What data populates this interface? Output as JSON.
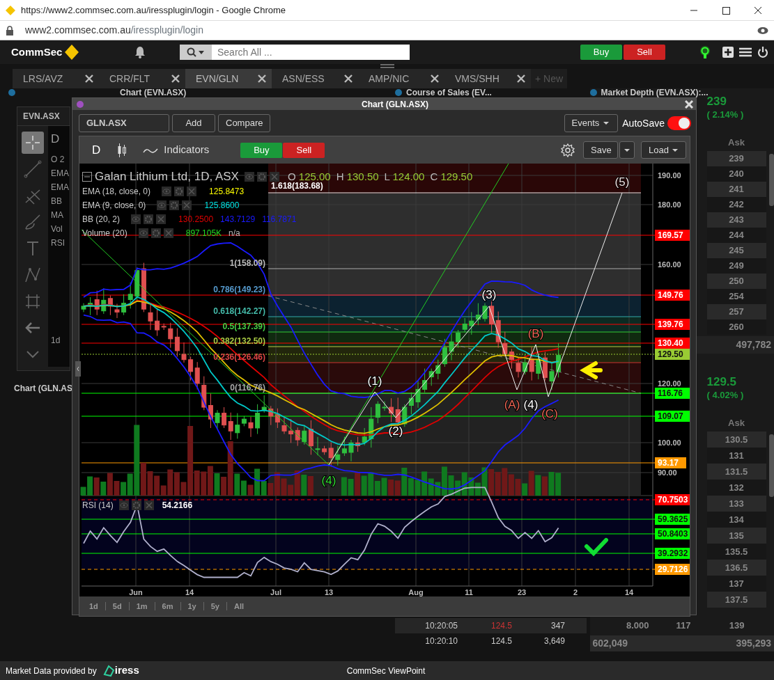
{
  "browser": {
    "title": "https://www2.commsec.com.au/iressplugin/login - Google Chrome",
    "url_host": "www2.commsec.com.au",
    "url_path": "/iressplugin/login"
  },
  "app_header": {
    "logo": "CommSec",
    "search_placeholder": "Search All ...",
    "buy": "Buy",
    "sell": "Sell"
  },
  "tabs": [
    {
      "label": "LRS/AVZ",
      "selected": false
    },
    {
      "label": "CRR/FLT",
      "selected": false
    },
    {
      "label": "EVN/GLN",
      "selected": true
    },
    {
      "label": "ASN/ESS",
      "selected": false
    },
    {
      "label": "AMP/NIC",
      "selected": false
    },
    {
      "label": "VMS/SHH",
      "selected": false
    }
  ],
  "new_tab": "+ New",
  "panels": [
    {
      "title": "Chart (EVN.ASX)"
    },
    {
      "title": "Course of Sales (EV..."
    },
    {
      "title": "Market Depth (EVN.ASX):..."
    }
  ],
  "left_panel": {
    "symbol": "EVN.ASX",
    "fragments": [
      "D",
      "O 2",
      "EMA",
      "EMA",
      "BB",
      "MA",
      "Vol",
      "RSI",
      "1d"
    ],
    "caption": "Chart (GLN.AS"
  },
  "course_of_sales": {
    "rows": [
      {
        "time": "10:20:05",
        "price": "124.5",
        "volume": "347",
        "down": true
      },
      {
        "time": "10:20:10",
        "price": "124.5",
        "volume": "3,649",
        "down": false
      }
    ]
  },
  "depth_top": {
    "price": "239",
    "change": "( 2.14% )",
    "ask_header": "Ask",
    "asks": [
      "239",
      "240",
      "241",
      "242",
      "243",
      "244",
      "245",
      "249",
      "250",
      "254",
      "257",
      "260"
    ],
    "total": "497,782"
  },
  "depth_bottom": {
    "price": "129.5",
    "change": "( 4.02% )",
    "ask_header": "Ask",
    "asks": [
      "130.5",
      "131",
      "131.5",
      "132",
      "133",
      "134",
      "135",
      "135.5",
      "136.5",
      "137",
      "137.5"
    ],
    "last_row": [
      "8.000",
      "117",
      "139"
    ],
    "totals": [
      "602,049",
      "395,293"
    ]
  },
  "chart_window": {
    "title": "Chart (GLN.ASX)",
    "symbol": "GLN.ASX",
    "add": "Add",
    "compare": "Compare",
    "events": "Events",
    "autosave": {
      "label": "AutoSave",
      "on": true
    },
    "toolbar": {
      "period": "D",
      "indicators": "Indicators",
      "buy": "Buy",
      "sell": "Sell",
      "save": "Save",
      "load": "Load"
    },
    "legend": {
      "title": "Galan Lithium Ltd, 1D, ASX",
      "ohlc": [
        {
          "key": "O",
          "value": "125.00"
        },
        {
          "key": "H",
          "value": "130.50"
        },
        {
          "key": "L",
          "value": "124.00"
        },
        {
          "key": "C",
          "value": "129.50"
        }
      ],
      "indicators": [
        {
          "name": "EMA (18, close, 0)",
          "values": [
            {
              "text": "125.8473",
              "color": "#ffff00"
            }
          ]
        },
        {
          "name": "EMA (9, close, 0)",
          "values": [
            {
              "text": "125.8600",
              "color": "#00e5e5"
            }
          ]
        },
        {
          "name": "BB (20, 2)",
          "values": [
            {
              "text": "130.2500",
              "color": "#e00000"
            },
            {
              "text": "143.7129",
              "color": "#1a1aff"
            },
            {
              "text": "116.7871",
              "color": "#1a1aff"
            }
          ]
        },
        {
          "name": "Volume (20)",
          "values": [
            {
              "text": "897.105K",
              "color": "#22dd22"
            },
            {
              "text": "n/a",
              "color": "#bbbbbb"
            }
          ]
        }
      ]
    },
    "fib_labels": [
      {
        "text": "1.618(183.68)",
        "color": "#ffffff"
      },
      {
        "text": "1(158.09)",
        "color": "#bbbbbb"
      },
      {
        "text": "0.786(149.23)",
        "color": "#5599cc"
      },
      {
        "text": "0.618(142.27)",
        "color": "#44bbaa"
      },
      {
        "text": "0.5(137.39)",
        "color": "#44cc44"
      },
      {
        "text": "0.382(132.50)",
        "color": "#aacc44"
      },
      {
        "text": "0.236(126.46)",
        "color": "#dd4444"
      },
      {
        "text": "0(116.76)",
        "color": "#aaaaaa"
      }
    ],
    "wave_labels": [
      {
        "text": "(5)",
        "color": "#f0dcdc"
      },
      {
        "text": "(3)",
        "color": "#ffffff"
      },
      {
        "text": "(1)",
        "color": "#ffffff"
      },
      {
        "text": "(2)",
        "color": "#ffffff"
      },
      {
        "text": "(4)",
        "color": "#33dd33"
      },
      {
        "text": "(B)",
        "color": "#ee6655"
      },
      {
        "text": "(A)",
        "color": "#ee6655"
      },
      {
        "text": "(4)",
        "color": "#ffffff"
      },
      {
        "text": "(C)",
        "color": "#ee6655"
      }
    ],
    "price_axis": [
      "190.00",
      "180.00",
      "160.00",
      "120.00",
      "100.00",
      "90.00"
    ],
    "level_labels": [
      {
        "text": "169.57",
        "color": "#ff0000"
      },
      {
        "text": "149.76",
        "color": "#ff0000"
      },
      {
        "text": "139.76",
        "color": "#ff0000"
      },
      {
        "text": "130.40",
        "color": "#ff0000"
      },
      {
        "text": "129.50",
        "color": "#99cc33"
      },
      {
        "text": "116.76",
        "color": "#00ff00"
      },
      {
        "text": "109.07",
        "color": "#00ff00"
      },
      {
        "text": "93.17",
        "color": "#ff9900"
      }
    ],
    "rsi": {
      "name": "RSI (14)",
      "value": "54.2166",
      "labels": [
        {
          "text": "70.7503",
          "color": "#ff0000"
        },
        {
          "text": "59.3625",
          "color": "#00ff00"
        },
        {
          "text": "50.8403",
          "color": "#00ff00"
        },
        {
          "text": "39.2932",
          "color": "#00ff00"
        },
        {
          "text": "29.7126",
          "color": "#ff9900"
        }
      ]
    },
    "x_axis": [
      "Jun",
      "14",
      "Jul",
      "13",
      "Aug",
      "11",
      "23",
      "2",
      "14"
    ],
    "ranges": [
      "1d",
      "5d",
      "1m",
      "6m",
      "1y",
      "5y",
      "All"
    ]
  },
  "footer": {
    "provider": "Market Data provided by",
    "provider_logo": "iress",
    "app_name": "CommSec ViewPoint"
  }
}
